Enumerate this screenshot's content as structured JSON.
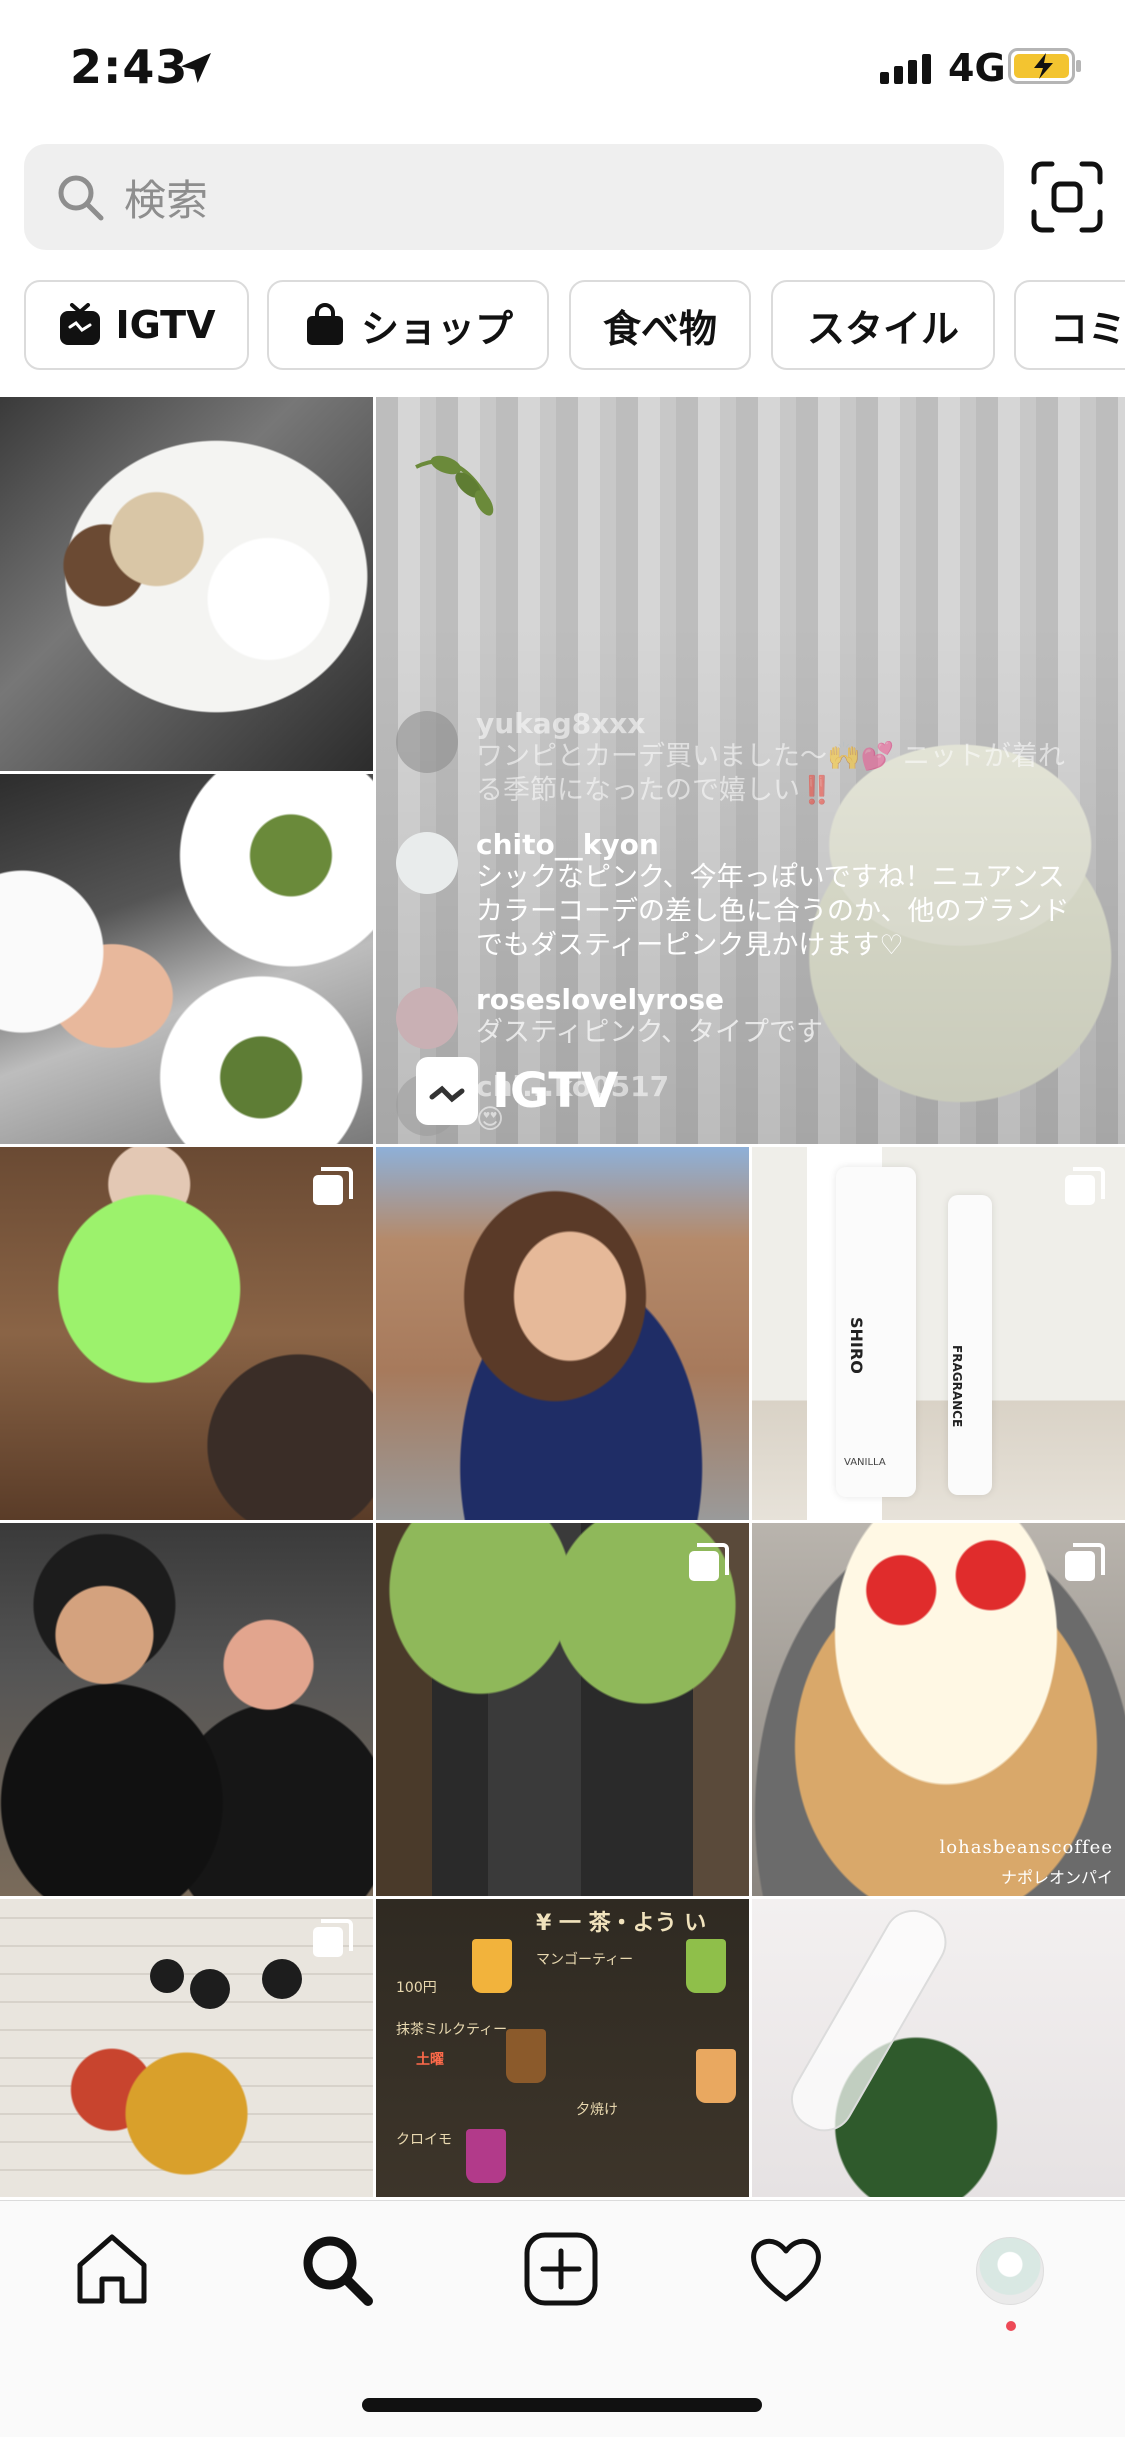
{
  "status": {
    "time": "2:43",
    "network": "4G"
  },
  "search": {
    "placeholder": "検索"
  },
  "chips": [
    {
      "label": "IGTV",
      "icon": "igtv-icon"
    },
    {
      "label": "ショップ",
      "icon": "shopping-bag-icon"
    },
    {
      "label": "食べ物"
    },
    {
      "label": "スタイル"
    },
    {
      "label": "コミ"
    }
  ],
  "igtv_post": {
    "badge": "IGTV",
    "comments": [
      {
        "user": "yukag8xxx",
        "text": "ワンピとカーデ買いました〜🙌💕 ニットが着れる季節になったので嬉しい‼️"
      },
      {
        "user": "chito__kyon",
        "text": "シックなピンク、今年っぽいですね！ニュアンスカラーコーデの差し色に合うのか、他のブランドでもダスティーピンク見かけます♡"
      },
      {
        "user": "roseslovelyrose",
        "text": "ダスティピンク、タイプです"
      },
      {
        "user": "chi...ko0517",
        "text": "😍"
      }
    ]
  },
  "shiro": {
    "brand": "SHIRO",
    "sub": "FRAGRANCE",
    "variant": "VANILLA"
  },
  "cake": {
    "caption": "lohasbeanscoffee",
    "subcaption": "ナポレオンパイ"
  },
  "menu": {
    "header": "¥ 一 茶・よう い",
    "items": [
      "マンゴーティー",
      "100円",
      "抹茶ミルクティー",
      "土曜",
      "夕焼け",
      "クロイモ"
    ]
  },
  "tabs": [
    "home-icon",
    "search-icon",
    "new-post-icon",
    "activity-heart-icon",
    "profile-avatar"
  ],
  "colors": {
    "notification_dot": "#ed4956",
    "chip_border": "#dbdbdb",
    "search_bg": "#efefef"
  }
}
